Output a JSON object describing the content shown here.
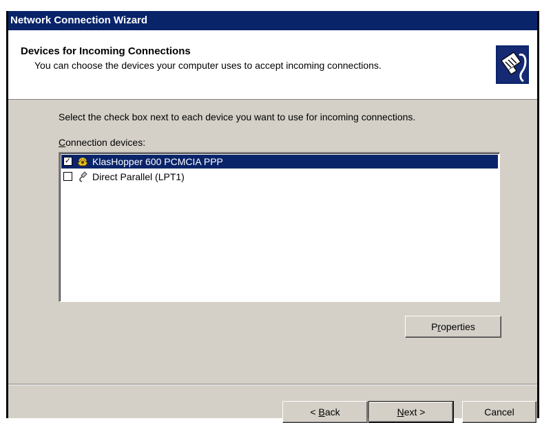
{
  "window": {
    "title": "Network Connection Wizard"
  },
  "header": {
    "title": "Devices for Incoming Connections",
    "subtitle": "You can choose the devices your computer uses to accept incoming connections.",
    "icon": "network-plug-icon"
  },
  "instruction": "Select the check box next to each device you want to use for incoming connections.",
  "device_list": {
    "label_prefix": "C",
    "label_rest": "onnection devices:",
    "items": [
      {
        "label": "KlasHopper 600 PCMCIA PPP",
        "checked": true,
        "selected": true,
        "icon": "modem-phone-icon"
      },
      {
        "label": "Direct Parallel (LPT1)",
        "checked": false,
        "selected": false,
        "icon": "parallel-cable-icon"
      }
    ]
  },
  "buttons": {
    "properties": {
      "pre": "P",
      "u": "r",
      "post": "operties"
    },
    "back": {
      "pre": "< ",
      "u": "B",
      "post": "ack"
    },
    "next": {
      "pre": "",
      "u": "N",
      "post": "ext >"
    },
    "cancel": "Cancel"
  }
}
